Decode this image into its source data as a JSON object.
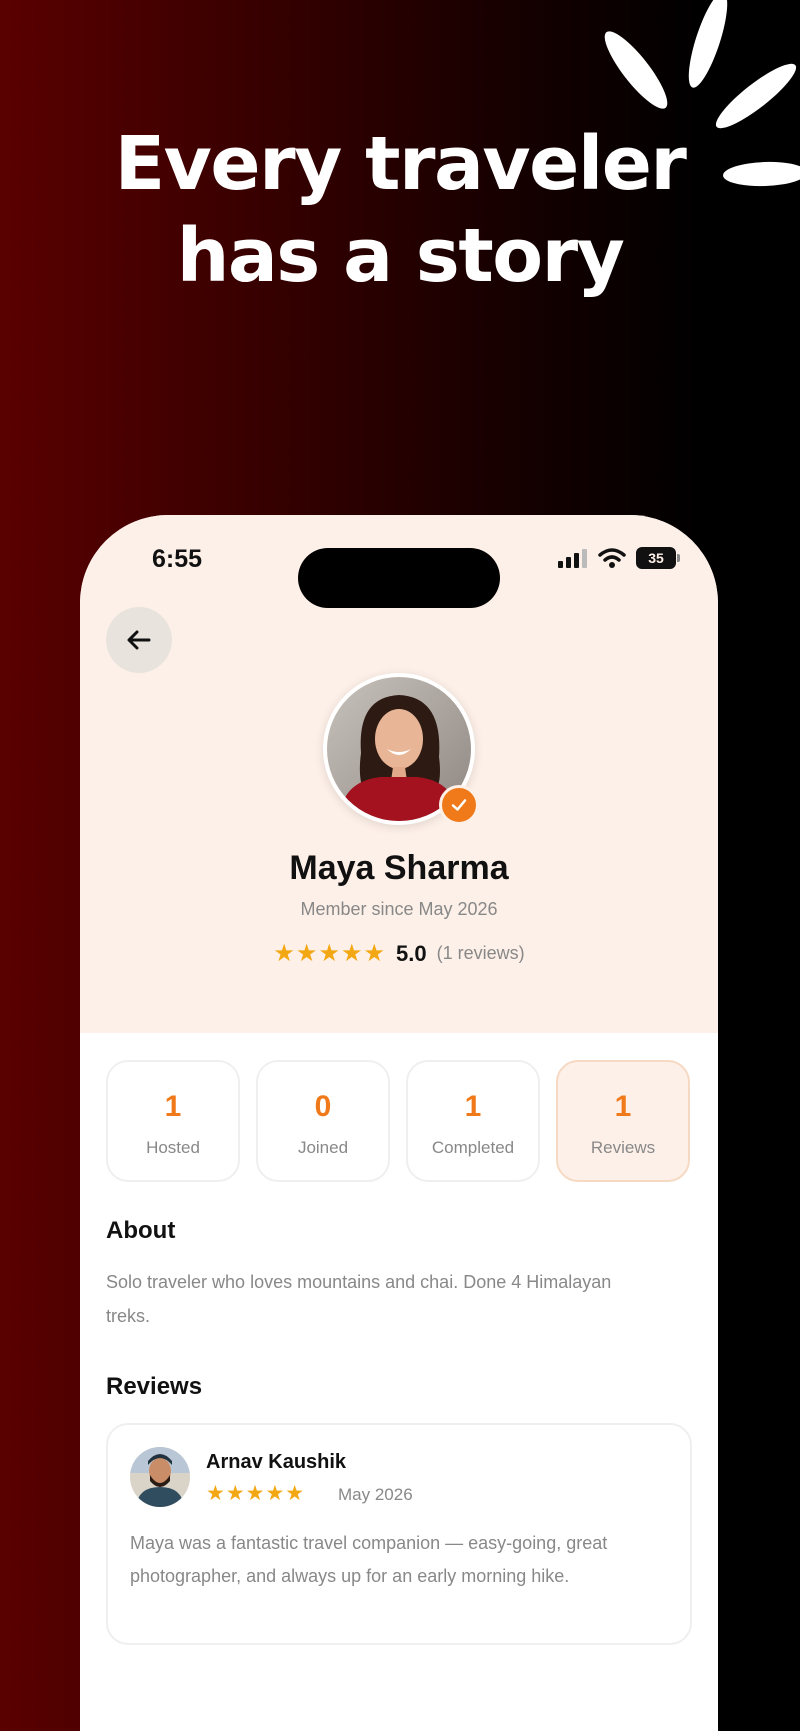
{
  "headline": {
    "line1": "Every traveler",
    "line2": "has a story"
  },
  "status_bar": {
    "time": "6:55",
    "battery": "35"
  },
  "profile": {
    "name": "Maya Sharma",
    "member_since": "Member since May 2026",
    "stars": "★★★★★",
    "rating": "5.0",
    "review_count": "(1 reviews)"
  },
  "stats": [
    {
      "value": "1",
      "label": "Hosted",
      "active": false
    },
    {
      "value": "0",
      "label": "Joined",
      "active": false
    },
    {
      "value": "1",
      "label": "Completed",
      "active": false
    },
    {
      "value": "1",
      "label": "Reviews",
      "active": true
    }
  ],
  "about": {
    "title": "About",
    "text": "Solo traveler who loves mountains and chai. Done 4 Himalayan treks."
  },
  "reviews": {
    "title": "Reviews",
    "items": [
      {
        "author": "Arnav Kaushik",
        "stars": "★★★★★",
        "date": "May 2026",
        "text": "Maya was a fantastic travel companion — easy-going, great photographer, and always up for an early morning hike."
      }
    ]
  },
  "colors": {
    "accent": "#f07a1a",
    "star": "#f3a712",
    "header_bg": "#fdf0e8",
    "page_bg_left": "#5a0000",
    "page_bg_right": "#000000"
  },
  "icons": {
    "back": "arrow-left-icon",
    "verified": "check-badge-icon",
    "signal": "signal-icon",
    "wifi": "wifi-icon",
    "battery": "battery-icon",
    "decor": "sparkle-icon"
  }
}
